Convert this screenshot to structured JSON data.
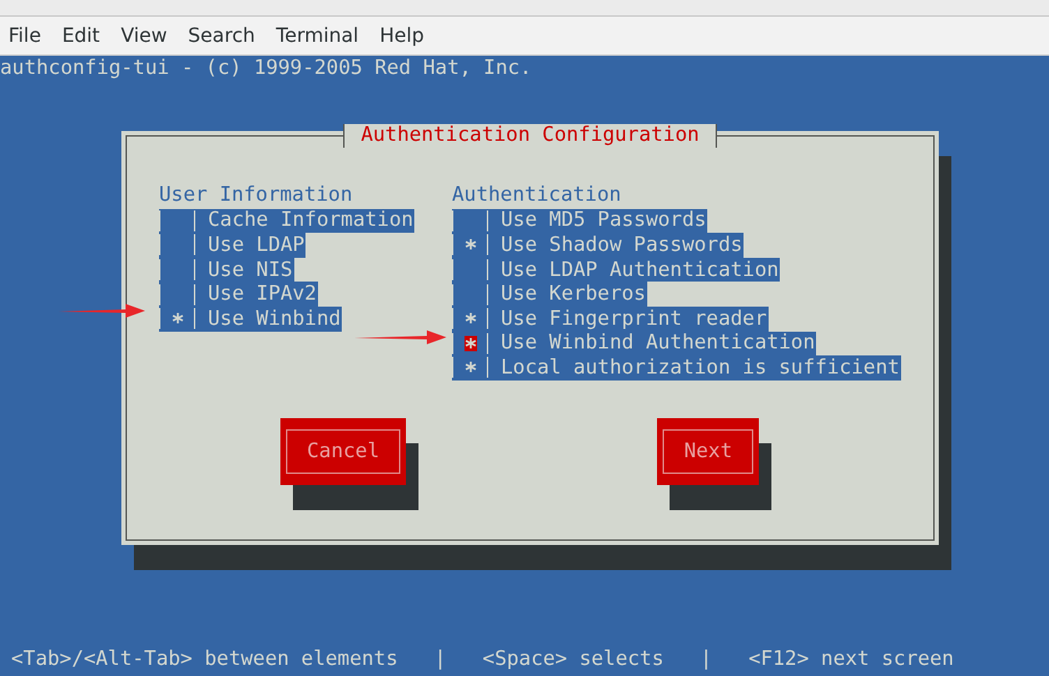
{
  "menu": [
    "File",
    "Edit",
    "View",
    "Search",
    "Terminal",
    "Help"
  ],
  "terminal": {
    "header": "authconfig-tui - (c) 1999-2005 Red Hat, Inc.",
    "dialog": {
      "title": "Authentication Configuration",
      "columns": [
        {
          "heading": "User Information",
          "items": [
            {
              "label": "Cache Information",
              "checked": false,
              "focused": false
            },
            {
              "label": "Use LDAP",
              "checked": false,
              "focused": false
            },
            {
              "label": "Use NIS",
              "checked": false,
              "focused": false
            },
            {
              "label": "Use IPAv2",
              "checked": false,
              "focused": false
            },
            {
              "label": "Use Winbind",
              "checked": true,
              "focused": false
            }
          ]
        },
        {
          "heading": "Authentication",
          "items": [
            {
              "label": "Use MD5 Passwords",
              "checked": false,
              "focused": false
            },
            {
              "label": "Use Shadow Passwords",
              "checked": true,
              "focused": false
            },
            {
              "label": "Use LDAP Authentication",
              "checked": false,
              "focused": false
            },
            {
              "label": "Use Kerberos",
              "checked": false,
              "focused": false
            },
            {
              "label": "Use Fingerprint reader",
              "checked": true,
              "focused": false
            },
            {
              "label": "Use Winbind Authentication",
              "checked": true,
              "focused": true
            },
            {
              "label": "Local authorization is sufficient",
              "checked": true,
              "focused": false
            }
          ]
        }
      ],
      "buttons": [
        "Cancel",
        "Next"
      ]
    },
    "footer": [
      "<Tab>/<Alt-Tab> between elements",
      "|",
      "<Space> selects",
      "|",
      "<F12> next screen"
    ]
  }
}
